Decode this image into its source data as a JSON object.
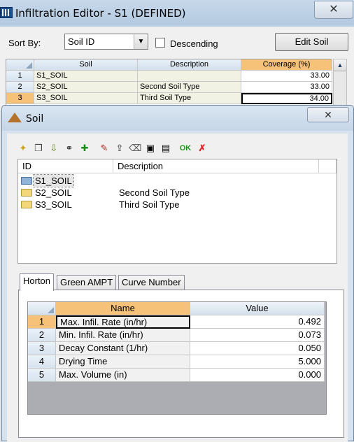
{
  "outer": {
    "title": "Infiltration Editor - S1 (DEFINED)",
    "close_glyph": "✕",
    "sort_by_label": "Sort By:",
    "sort_select_value": "Soil ID",
    "descending_label": "Descending",
    "edit_soil_label": "Edit Soil",
    "coverage_grid": {
      "headers": [
        "Soil",
        "Description",
        "Coverage (%)"
      ],
      "rows": [
        {
          "num": "1",
          "soil": "S1_SOIL",
          "desc": "",
          "coverage": "33.00"
        },
        {
          "num": "2",
          "soil": "S2_SOIL",
          "desc": "Second Soil Type",
          "coverage": "33.00"
        },
        {
          "num": "3",
          "soil": "S3_SOIL",
          "desc": "Third Soil Type",
          "coverage": "34.00"
        }
      ]
    }
  },
  "soil_dialog": {
    "title": "Soil",
    "close_glyph": "✕",
    "toolbar_icons": [
      "new-icon",
      "copy-icon",
      "import-icon",
      "link-icon",
      "add-icon",
      "edit-icon",
      "export-icon",
      "erase-icon",
      "save-icon",
      "save-as-icon",
      "ok-icon",
      "cancel-icon"
    ],
    "ok_label": "OK",
    "list": {
      "headers": [
        "ID",
        "Description"
      ],
      "rows": [
        {
          "id": "S1_SOIL",
          "desc": ""
        },
        {
          "id": "S2_SOIL",
          "desc": "Second Soil Type"
        },
        {
          "id": "S3_SOIL",
          "desc": "Third Soil Type"
        }
      ]
    },
    "tabs": [
      "Horton",
      "Green AMPT",
      "Curve Number"
    ],
    "horton_grid": {
      "headers": [
        "Name",
        "Value"
      ],
      "rows": [
        {
          "num": "1",
          "name": "Max. Infil. Rate (in/hr)",
          "value": "0.492"
        },
        {
          "num": "2",
          "name": "Min. Infil. Rate (in/hr)",
          "value": "0.073"
        },
        {
          "num": "3",
          "name": "Decay Constant (1/hr)",
          "value": "0.050"
        },
        {
          "num": "4",
          "name": "Drying Time",
          "value": "5.000"
        },
        {
          "num": "5",
          "name": "Max. Volume (in)",
          "value": "0.000"
        }
      ]
    }
  }
}
